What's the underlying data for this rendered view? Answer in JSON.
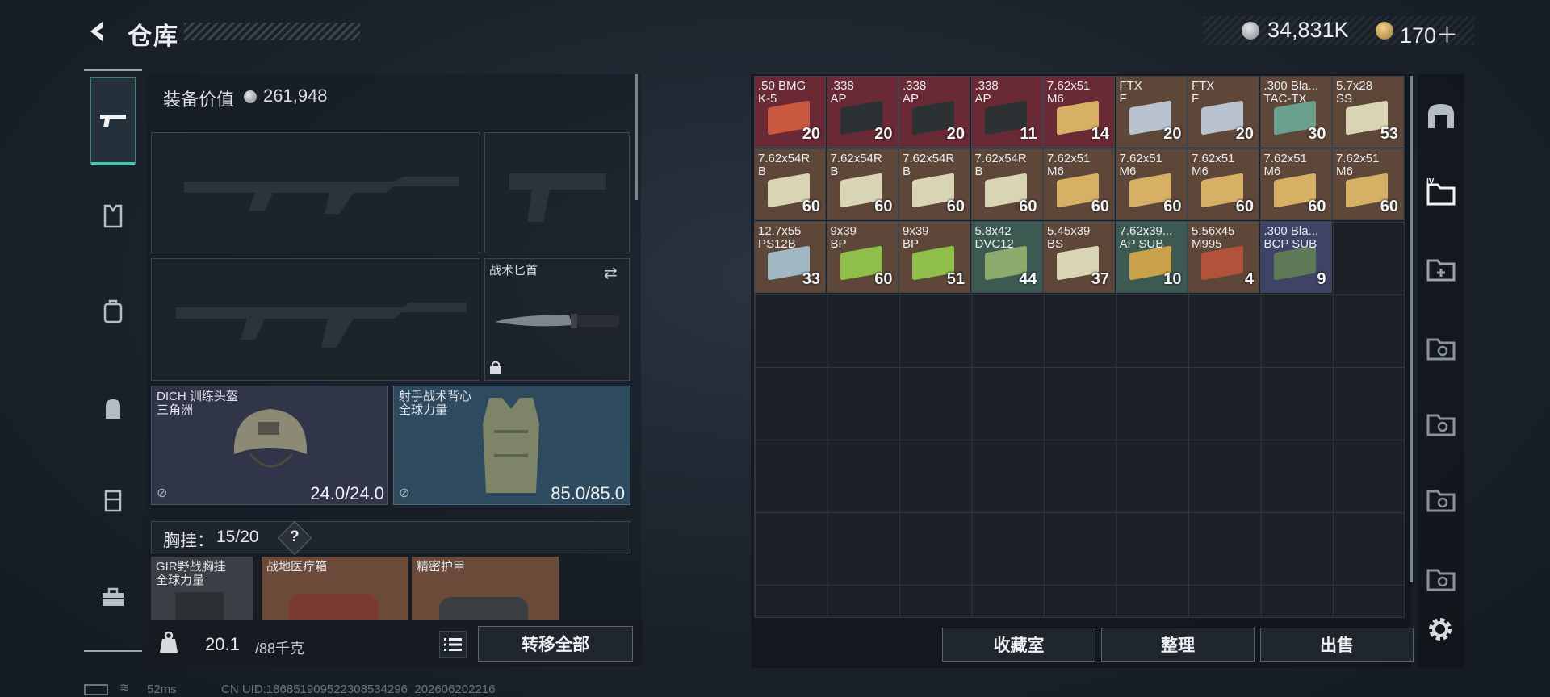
{
  "header": {
    "title": "仓库"
  },
  "currency": {
    "money": "34,831K",
    "premium": "170＋"
  },
  "rail": {
    "items": [
      "weapons-icon",
      "armor-icon",
      "pouch-icon",
      "backpack-icon",
      "rig-icon",
      "case-icon"
    ]
  },
  "equipment": {
    "value_label": "装备价值",
    "value": "261,948",
    "knife": {
      "label": "战术匕首"
    },
    "helmet": {
      "name_line1": "DICH 训练头盔",
      "name_line2": "三角洲",
      "durability": "24.0/24.0"
    },
    "vest": {
      "name_line1": "射手战术背心",
      "name_line2": "全球力量",
      "durability": "85.0/85.0"
    },
    "rig": {
      "label": "胸挂：",
      "count": "15/20",
      "help": "?",
      "slots": [
        {
          "name_line1": "GIR野战胸挂",
          "name_line2": "全球力量"
        },
        {
          "name_line1": "战地医疗箱",
          "name_line2": ""
        },
        {
          "name_line1": "精密护甲",
          "name_line2": ""
        }
      ]
    }
  },
  "weight": {
    "current": "20.1",
    "max": "/88千克"
  },
  "buttons": {
    "transfer_all": "转移全部",
    "collection": "收藏室",
    "sort": "整理",
    "sell": "出售"
  },
  "status": {
    "ping": "52ms",
    "uid": "CN UID:1868519095223085342​96_202606202216"
  },
  "stash": {
    "rows": [
      [
        {
          "cal": ".50 BMG\nK-5",
          "qty": "20",
          "bg": "red",
          "box": "#c8583e"
        },
        {
          "cal": ".338\nAP",
          "qty": "20",
          "bg": "red",
          "box": "#2c3134"
        },
        {
          "cal": ".338\nAP",
          "qty": "20",
          "bg": "red",
          "box": "#2c3134"
        },
        {
          "cal": ".338\nAP",
          "qty": "11",
          "bg": "red",
          "box": "#2c3134"
        },
        {
          "cal": "7.62x51\nM6",
          "qty": "14",
          "bg": "red",
          "box": "#d6b064"
        },
        {
          "cal": "FTX\nF",
          "qty": "20",
          "bg": "brown",
          "box": "#b9c3d0"
        },
        {
          "cal": "FTX\nF",
          "qty": "20",
          "bg": "brown",
          "box": "#b9c3d0"
        },
        {
          "cal": ".300 Bla...\nTAC-TX",
          "qty": "30",
          "bg": "brown",
          "box": "#6aa08d"
        },
        {
          "cal": "5.7x28\nSS",
          "qty": "53",
          "bg": "brown",
          "box": "#d9d4b4"
        }
      ],
      [
        {
          "cal": "7.62x54R\nB",
          "qty": "60",
          "bg": "brown",
          "box": "#d9d4b4"
        },
        {
          "cal": "7.62x54R\nB",
          "qty": "60",
          "bg": "brown",
          "box": "#d9d4b4"
        },
        {
          "cal": "7.62x54R\nB",
          "qty": "60",
          "bg": "brown",
          "box": "#d9d4b4"
        },
        {
          "cal": "7.62x54R\nB",
          "qty": "60",
          "bg": "brown",
          "box": "#d9d4b4"
        },
        {
          "cal": "7.62x51\nM6",
          "qty": "60",
          "bg": "brown",
          "box": "#d6b064"
        },
        {
          "cal": "7.62x51\nM6",
          "qty": "60",
          "bg": "brown",
          "box": "#d6b064"
        },
        {
          "cal": "7.62x51\nM6",
          "qty": "60",
          "bg": "brown",
          "box": "#d6b064"
        },
        {
          "cal": "7.62x51\nM6",
          "qty": "60",
          "bg": "brown",
          "box": "#d6b064"
        },
        {
          "cal": "7.62x51\nM6",
          "qty": "60",
          "bg": "brown",
          "box": "#d6b064"
        }
      ],
      [
        {
          "cal": "12.7x55\nPS12B",
          "qty": "33",
          "bg": "brown",
          "box": "#9fb8c4"
        },
        {
          "cal": "9x39\nBP",
          "qty": "60",
          "bg": "brown",
          "box": "#8fbf4a"
        },
        {
          "cal": "9x39\nBP",
          "qty": "51",
          "bg": "brown",
          "box": "#8fbf4a"
        },
        {
          "cal": "5.8x42\nDVC12",
          "qty": "44",
          "bg": "green",
          "box": "#8dab6c"
        },
        {
          "cal": "5.45x39\nBS",
          "qty": "37",
          "bg": "brown",
          "box": "#d9d4b4"
        },
        {
          "cal": "7.62x39...\nAP SUB",
          "qty": "10",
          "bg": "green",
          "box": "#c9a14a"
        },
        {
          "cal": "5.56x45\nM995",
          "qty": "4",
          "bg": "brown",
          "box": "#b0533a"
        },
        {
          "cal": ".300 Bla...\nBCP SUB",
          "qty": "9",
          "bg": "purple",
          "box": "#5f7a56"
        }
      ]
    ]
  }
}
